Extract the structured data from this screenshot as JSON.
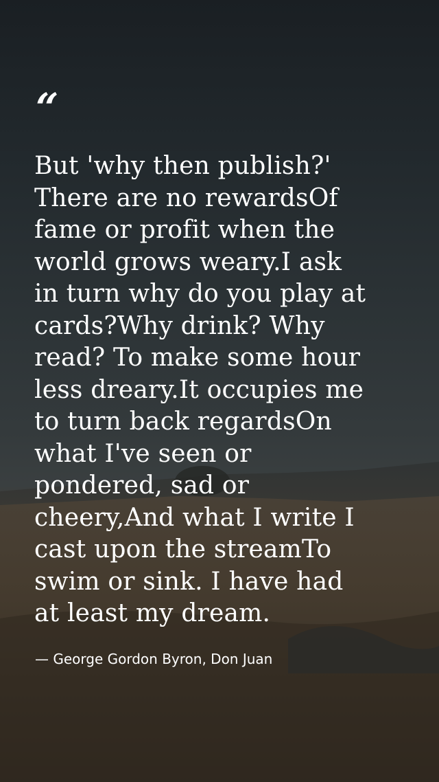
{
  "quote": {
    "mark": "“",
    "lines": [
      "But 'why then publish?'",
      "There are no rewardsOf",
      "fame or profit when the",
      "world grows weary.I ask",
      "in turn why do you play at",
      "cards?Why drink? Why",
      "read? To make some hour",
      "less dreary.It occupies me",
      "to turn back regardsOn",
      "what I've seen or",
      "pondered, sad or",
      "cheery,And what I write I",
      "cast upon the streamTo",
      "swim or sink. I have had",
      "at least my dream."
    ],
    "attribution": "— George Gordon Byron, Don Juan"
  },
  "background": {
    "description_colors": {
      "sky_top": "#1a1f23",
      "horizon": "#3a3f40",
      "grass": "#3b3327"
    }
  }
}
